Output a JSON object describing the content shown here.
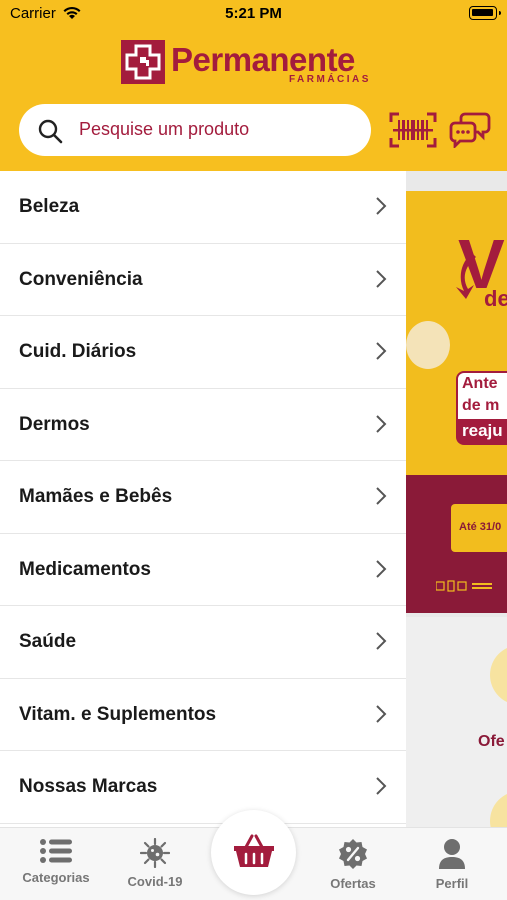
{
  "status_bar": {
    "carrier": "Carrier",
    "time": "5:21 PM"
  },
  "brand": {
    "name": "Permanente",
    "subtitle": "FARMÁCIAS",
    "primary_color": "#a31c3d",
    "accent_color": "#f7bf1f"
  },
  "search": {
    "placeholder": "Pesquise um produto",
    "icon": "search-icon"
  },
  "header_actions": [
    {
      "icon": "barcode-scanner-icon"
    },
    {
      "icon": "chat-icon"
    }
  ],
  "categories": [
    {
      "label": "Beleza"
    },
    {
      "label": "Conveniência"
    },
    {
      "label": "Cuid. Diários"
    },
    {
      "label": "Dermos"
    },
    {
      "label": "Mamães e Bebês"
    },
    {
      "label": "Medicamentos"
    },
    {
      "label": "Saúde"
    },
    {
      "label": "Vitam. e Suplementos"
    },
    {
      "label": "Nossas Marcas"
    }
  ],
  "background_banner": {
    "big_text": "V",
    "small_text": "de",
    "box_lines": [
      "Ante",
      "de m"
    ],
    "strip_text": "reaju",
    "date_text": "Até 31/0",
    "offers_text": "Ofe"
  },
  "tabbar": {
    "items": [
      {
        "label": "Categorias",
        "icon": "list-icon"
      },
      {
        "label": "Covid-19",
        "icon": "virus-icon"
      },
      {
        "label": "",
        "icon": "basket-icon"
      },
      {
        "label": "Ofertas",
        "icon": "discount-badge-icon"
      },
      {
        "label": "Perfil",
        "icon": "user-icon"
      }
    ]
  }
}
